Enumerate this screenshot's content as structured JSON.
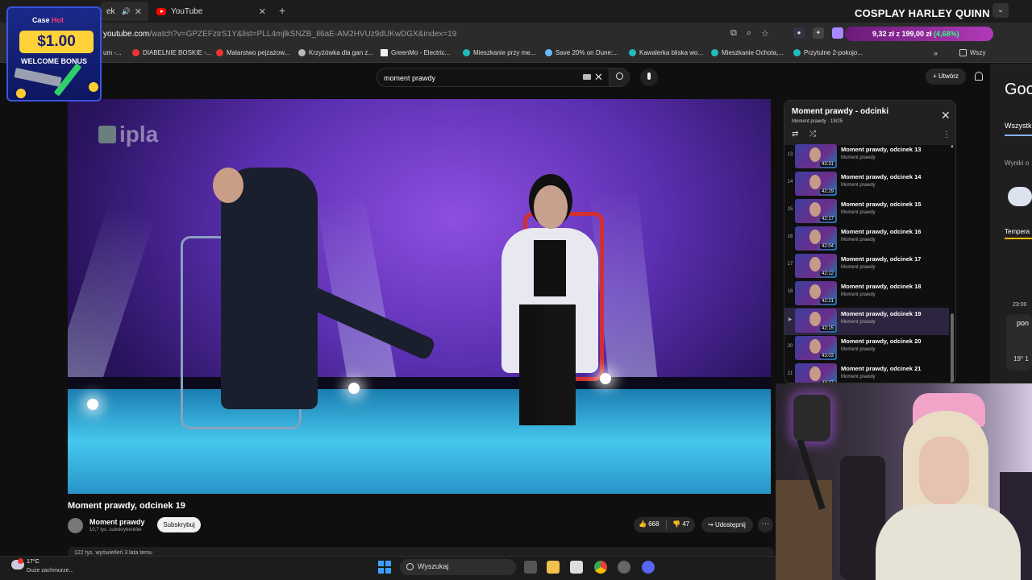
{
  "browser": {
    "tab1_label": "ek",
    "tab2_label": "YouTube",
    "overlay_title": "COSPLAY HARLEY QUINN",
    "url_host": "youtube.com",
    "url_path": "/watch?v=GPZEFztrS1Y&list=PLL4mjlkSNZB_Il6aE-AM2HVUz9dUKwDGX&index=19",
    "price_text": "9,32 zł z 199,00 zł",
    "price_pct": "(4,68%)",
    "bookmarks": [
      "um -...",
      "DIABELNIE BOSKIE -...",
      "Malarstwo pejzażow...",
      "Krzyżówka dla gan z...",
      "GreenMo - Electric...",
      "Mieszkanie przy me...",
      "Save 20% on Dune:...",
      "Kawalerka bliska wo...",
      "Mieszkanie Ochota,...",
      "Przytulne 2-pokojo...",
      "Wszy"
    ]
  },
  "casino": {
    "brand": "Case",
    "brand_hot": "Hot",
    "amount": "$1.00",
    "bonus": "WELCOME BONUS"
  },
  "youtube": {
    "search_value": "moment prawdy",
    "create_label": "+ Utwórz",
    "video_logo": "ipla",
    "video_title": "Moment prawdy, odcinek 19",
    "channel_name": "Moment prawdy",
    "channel_subs": "10,7 tys. subskrybentów",
    "subscribe_label": "Subskrybuj",
    "likes": "668",
    "dislikes": "47",
    "share_label": "Udostępnij",
    "desc_preview": "122 tys. wyświetleń  3 lata temu"
  },
  "playlist": {
    "title": "Moment prawdy - odcinki",
    "subtitle": "Moment prawdy · 19/25",
    "items": [
      {
        "index": "13",
        "title": "Moment prawdy, odcinek 13",
        "channel": "Moment prawdy",
        "duration": "43:31"
      },
      {
        "index": "14",
        "title": "Moment prawdy, odcinek 14",
        "channel": "Moment prawdy",
        "duration": "42:29"
      },
      {
        "index": "15",
        "title": "Moment prawdy, odcinek 15",
        "channel": "Moment prawdy",
        "duration": "42:17"
      },
      {
        "index": "16",
        "title": "Moment prawdy, odcinek 16",
        "channel": "Moment prawdy",
        "duration": "42:04"
      },
      {
        "index": "17",
        "title": "Moment prawdy, odcinek 17",
        "channel": "Moment prawdy",
        "duration": "42:12"
      },
      {
        "index": "18",
        "title": "Moment prawdy, odcinek 18",
        "channel": "Moment prawdy",
        "duration": "42:21"
      },
      {
        "index": "▶",
        "title": "Moment prawdy, odcinek 19",
        "channel": "Moment prawdy",
        "duration": "42:15"
      },
      {
        "index": "20",
        "title": "Moment prawdy, odcinek 20",
        "channel": "Moment prawdy",
        "duration": "43:03"
      },
      {
        "index": "21",
        "title": "Moment prawdy, odcinek 21",
        "channel": "Moment prawdy",
        "duration": "43:27"
      }
    ]
  },
  "google": {
    "logo": "Goo",
    "tab": "Wszystk",
    "results": "Wyniki o",
    "temp_label": "Tempera",
    "time": "23:00",
    "day": "pon",
    "deg": "19° 1"
  },
  "taskbar": {
    "temp": "17°C",
    "weather": "Duże zachmurze...",
    "search_label": "Wyszukaj"
  },
  "colors": {
    "yt_red": "#ff0000",
    "accent_blue": "#3aa0ff",
    "pill_green": "#2dff7a"
  }
}
